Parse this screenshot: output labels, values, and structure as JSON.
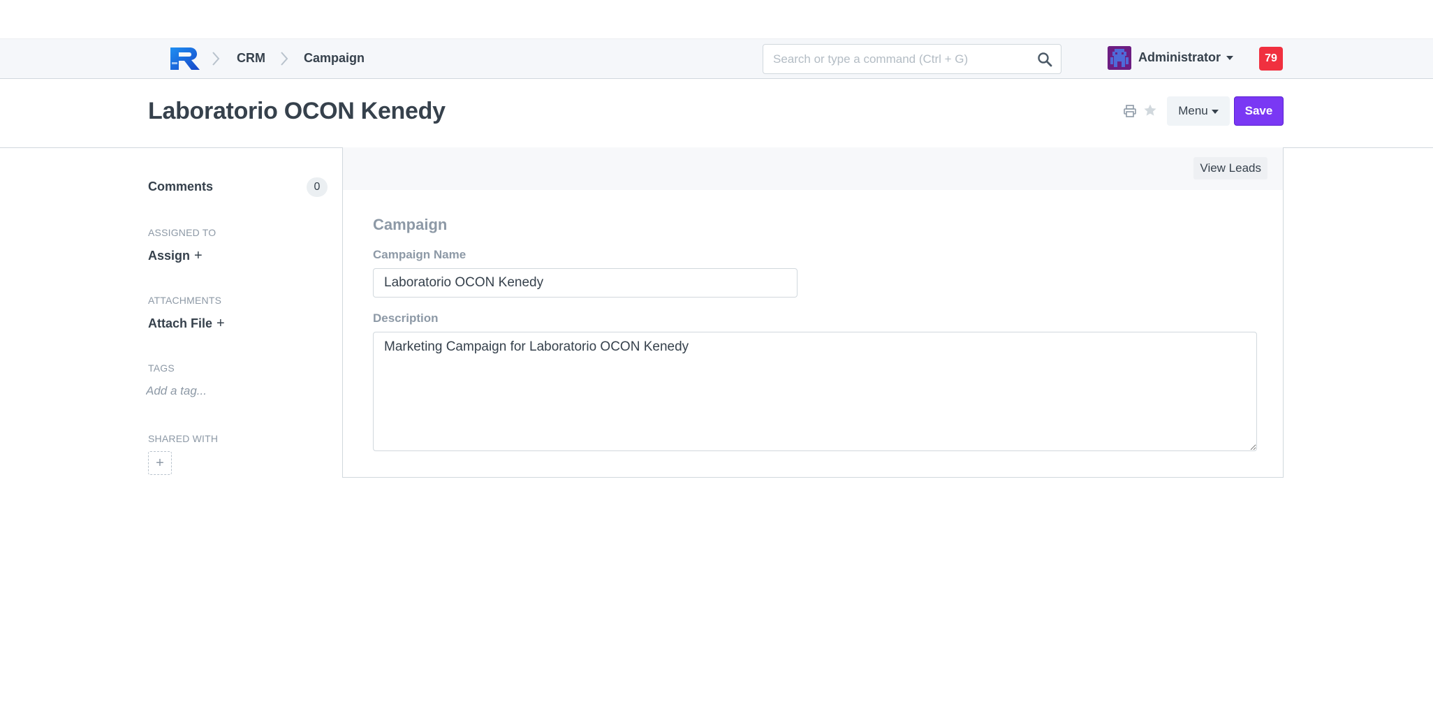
{
  "navbar": {
    "breadcrumbs": [
      "CRM",
      "Campaign"
    ],
    "search_placeholder": "Search or type a command (Ctrl + G)",
    "user_name": "Administrator",
    "notification_count": "79"
  },
  "page": {
    "title": "Laboratorio OCON Kenedy",
    "menu_label": "Menu",
    "save_label": "Save"
  },
  "sidebar": {
    "comments_label": "Comments",
    "comments_count": "0",
    "assigned_to_label": "ASSIGNED TO",
    "assign_label": "Assign",
    "attachments_label": "ATTACHMENTS",
    "attach_label": "Attach File",
    "tags_label": "TAGS",
    "tag_placeholder": "Add a tag...",
    "shared_with_label": "SHARED WITH",
    "share_add": "+"
  },
  "form": {
    "view_leads_label": "View Leads",
    "section_title": "Campaign",
    "campaign_name_label": "Campaign Name",
    "campaign_name_value": "Laboratorio OCON Kenedy",
    "description_label": "Description",
    "description_value": "Marketing Campaign for Laboratorio OCON Kenedy"
  },
  "colors": {
    "primary": "#7a38f4",
    "notification": "#f0303f",
    "text": "#36414c",
    "muted": "#8d99a6"
  }
}
